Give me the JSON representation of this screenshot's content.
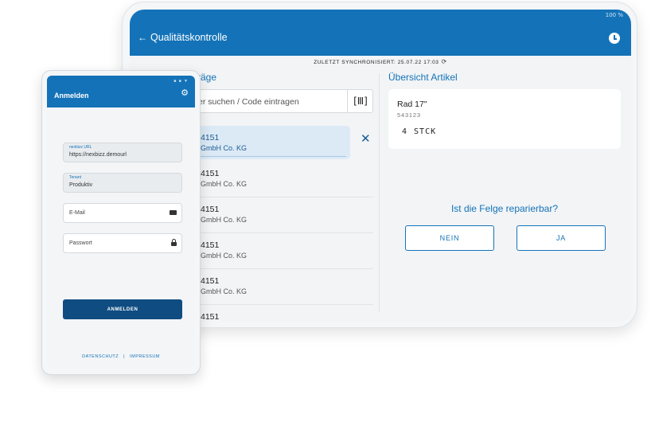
{
  "tablet": {
    "status_bar": "100 %",
    "title": "Qualitätskontrolle",
    "back_icon": "arrow-left-icon",
    "clock_icon": "clock-icon",
    "sync_text": "ZULETZT SYNCHRONISIERT: 25.07.22 17:03",
    "sync_icon": "refresh-icon",
    "orders_heading": "räge",
    "search_placeholder": "er suchen / Code eintragen",
    "scan_icon": "barcode-icon",
    "orders": [
      {
        "number": "4151",
        "company": "GmbH Co. KG",
        "selected": true
      },
      {
        "number": "4151",
        "company": "GmbH Co. KG",
        "selected": false
      },
      {
        "number": "4151",
        "company": "GmbH Co. KG",
        "selected": false
      },
      {
        "number": "4151",
        "company": "GmbH Co. KG",
        "selected": false
      },
      {
        "number": "4151",
        "company": "GmbH Co. KG",
        "selected": false
      },
      {
        "number": "4151",
        "company": "",
        "selected": false
      }
    ],
    "close_icon": "close-icon",
    "overview_heading": "Übersicht Artikel",
    "article": {
      "name": "Rad 17\"",
      "code": "543123",
      "qty": "4",
      "unit": "STCK"
    },
    "question": "Ist die Felge reparierbar?",
    "btn_no": "NEIN",
    "btn_yes": "JA",
    "colors": {
      "primary": "#1473b8",
      "selected_bg": "#dceaf6"
    }
  },
  "phone": {
    "title": "Anmelden",
    "gear_icon": "gear-icon",
    "url_label": "nexbizz URL",
    "url_value": "https://nexbizz.demourl",
    "tenant_label": "Tenant",
    "tenant_value": "Produktiv",
    "email_placeholder": "E-Mail",
    "password_placeholder": "Passwort",
    "login_button": "ANMELDEN",
    "footer_privacy": "DATENSCHUTZ",
    "footer_separator": "|",
    "footer_imprint": "IMPRESSUM",
    "colors": {
      "button": "#0f4c81"
    }
  }
}
